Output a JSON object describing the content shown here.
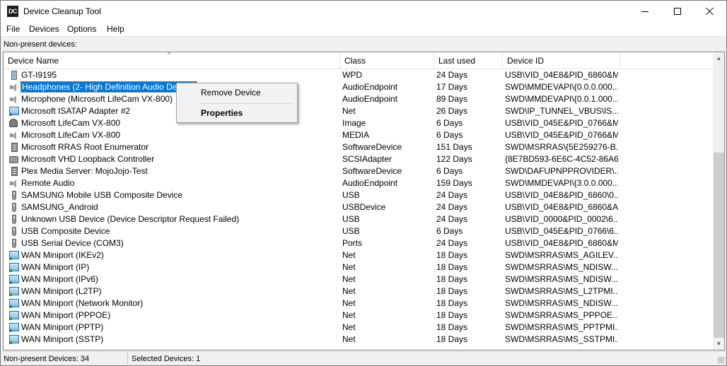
{
  "window": {
    "icon_text": "DC",
    "title": "Device Cleanup Tool"
  },
  "menu": [
    "File",
    "Devices",
    "Options",
    "Help"
  ],
  "section_label": "Non-present devices:",
  "columns": {
    "name": "Device Name",
    "class": "Class",
    "last_used": "Last used",
    "device_id": "Device ID"
  },
  "rows": [
    {
      "icon": "phone-icon",
      "name": "GT-I9195",
      "class": "WPD",
      "last_used": "24 Days",
      "device_id": "USB\\VID_04E8&PID_6860&M..."
    },
    {
      "icon": "speaker-icon",
      "name": "Headphones (2- High Definition Audio Device)",
      "class": "AudioEndpoint",
      "last_used": "17 Days",
      "device_id": "SWD\\MMDEVAPI\\{0.0.0.000..."
    },
    {
      "icon": "speaker-icon",
      "name": "Microphone (Microsoft LifeCam VX-800)",
      "class": "AudioEndpoint",
      "last_used": "89 Days",
      "device_id": "SWD\\MMDEVAPI\\{0.0.1.000..."
    },
    {
      "icon": "network-icon",
      "name": "Microsoft ISATAP Adapter #2",
      "class": "Net",
      "last_used": "26 Days",
      "device_id": "SWD\\IP_TUNNEL_VBUS\\IS..."
    },
    {
      "icon": "camera-icon",
      "name": "Microsoft LifeCam VX-800",
      "class": "Image",
      "last_used": "6 Days",
      "device_id": "USB\\VID_045E&PID_0766&M..."
    },
    {
      "icon": "speaker-icon",
      "name": "Microsoft LifeCam VX-800",
      "class": "MEDIA",
      "last_used": "6 Days",
      "device_id": "USB\\VID_045E&PID_0766&M..."
    },
    {
      "icon": "server-icon",
      "name": "Microsoft RRAS Root Enumerator",
      "class": "SoftwareDevice",
      "last_used": "151 Days",
      "device_id": "SWD\\MSRRAS\\{5E259276-B..."
    },
    {
      "icon": "disk-icon",
      "name": "Microsoft VHD Loopback Controller",
      "class": "SCSIAdapter",
      "last_used": "122 Days",
      "device_id": "{8E7BD593-6E6C-4C52-86A6-..."
    },
    {
      "icon": "server-icon",
      "name": "Plex Media Server: MojoJojo-Test",
      "class": "SoftwareDevice",
      "last_used": "6 Days",
      "device_id": "SWD\\DAFUPNPPROVIDER\\..."
    },
    {
      "icon": "speaker-icon",
      "name": "Remote Audio",
      "class": "AudioEndpoint",
      "last_used": "159 Days",
      "device_id": "SWD\\MMDEVAPI\\{3.0.0.000..."
    },
    {
      "icon": "usb-icon",
      "name": "SAMSUNG Mobile USB Composite Device",
      "class": "USB",
      "last_used": "24 Days",
      "device_id": "USB\\VID_04E8&PID_6860\\0..."
    },
    {
      "icon": "usb-icon",
      "name": "SAMSUNG_Android",
      "class": "USBDevice",
      "last_used": "24 Days",
      "device_id": "USB\\VID_04E8&PID_6860&A..."
    },
    {
      "icon": "usb-icon",
      "name": "Unknown USB Device (Device Descriptor Request Failed)",
      "class": "USB",
      "last_used": "24 Days",
      "device_id": "USB\\VID_0000&PID_0002\\6..."
    },
    {
      "icon": "usb-icon",
      "name": "USB Composite Device",
      "class": "USB",
      "last_used": "6 Days",
      "device_id": "USB\\VID_045E&PID_0766\\6..."
    },
    {
      "icon": "usb-icon",
      "name": "USB Serial Device (COM3)",
      "class": "Ports",
      "last_used": "24 Days",
      "device_id": "USB\\VID_04E8&PID_6860&M..."
    },
    {
      "icon": "network-icon",
      "name": "WAN Miniport (IKEv2)",
      "class": "Net",
      "last_used": "18 Days",
      "device_id": "SWD\\MSRRAS\\MS_AGILEV..."
    },
    {
      "icon": "network-icon",
      "name": "WAN Miniport (IP)",
      "class": "Net",
      "last_used": "18 Days",
      "device_id": "SWD\\MSRRAS\\MS_NDISW..."
    },
    {
      "icon": "network-icon",
      "name": "WAN Miniport (IPv6)",
      "class": "Net",
      "last_used": "18 Days",
      "device_id": "SWD\\MSRRAS\\MS_NDISW..."
    },
    {
      "icon": "network-icon",
      "name": "WAN Miniport (L2TP)",
      "class": "Net",
      "last_used": "18 Days",
      "device_id": "SWD\\MSRRAS\\MS_L2TPMI..."
    },
    {
      "icon": "network-icon",
      "name": "WAN Miniport (Network Monitor)",
      "class": "Net",
      "last_used": "18 Days",
      "device_id": "SWD\\MSRRAS\\MS_NDISW..."
    },
    {
      "icon": "network-icon",
      "name": "WAN Miniport (PPPOE)",
      "class": "Net",
      "last_used": "18 Days",
      "device_id": "SWD\\MSRRAS\\MS_PPPOE..."
    },
    {
      "icon": "network-icon",
      "name": "WAN Miniport (PPTP)",
      "class": "Net",
      "last_used": "18 Days",
      "device_id": "SWD\\MSRRAS\\MS_PPTPMI..."
    },
    {
      "icon": "network-icon",
      "name": "WAN Miniport (SSTP)",
      "class": "Net",
      "last_used": "18 Days",
      "device_id": "SWD\\MSRRAS\\MS_SSTPMI..."
    }
  ],
  "selected_row": 1,
  "context_menu": {
    "remove": "Remove Device",
    "properties": "Properties"
  },
  "status": {
    "non_present": "Non-present Devices: 34",
    "selected": "Selected Devices: 1"
  },
  "colors": {
    "selection": "#0078d7",
    "window_bg": "#f0f0f0"
  }
}
